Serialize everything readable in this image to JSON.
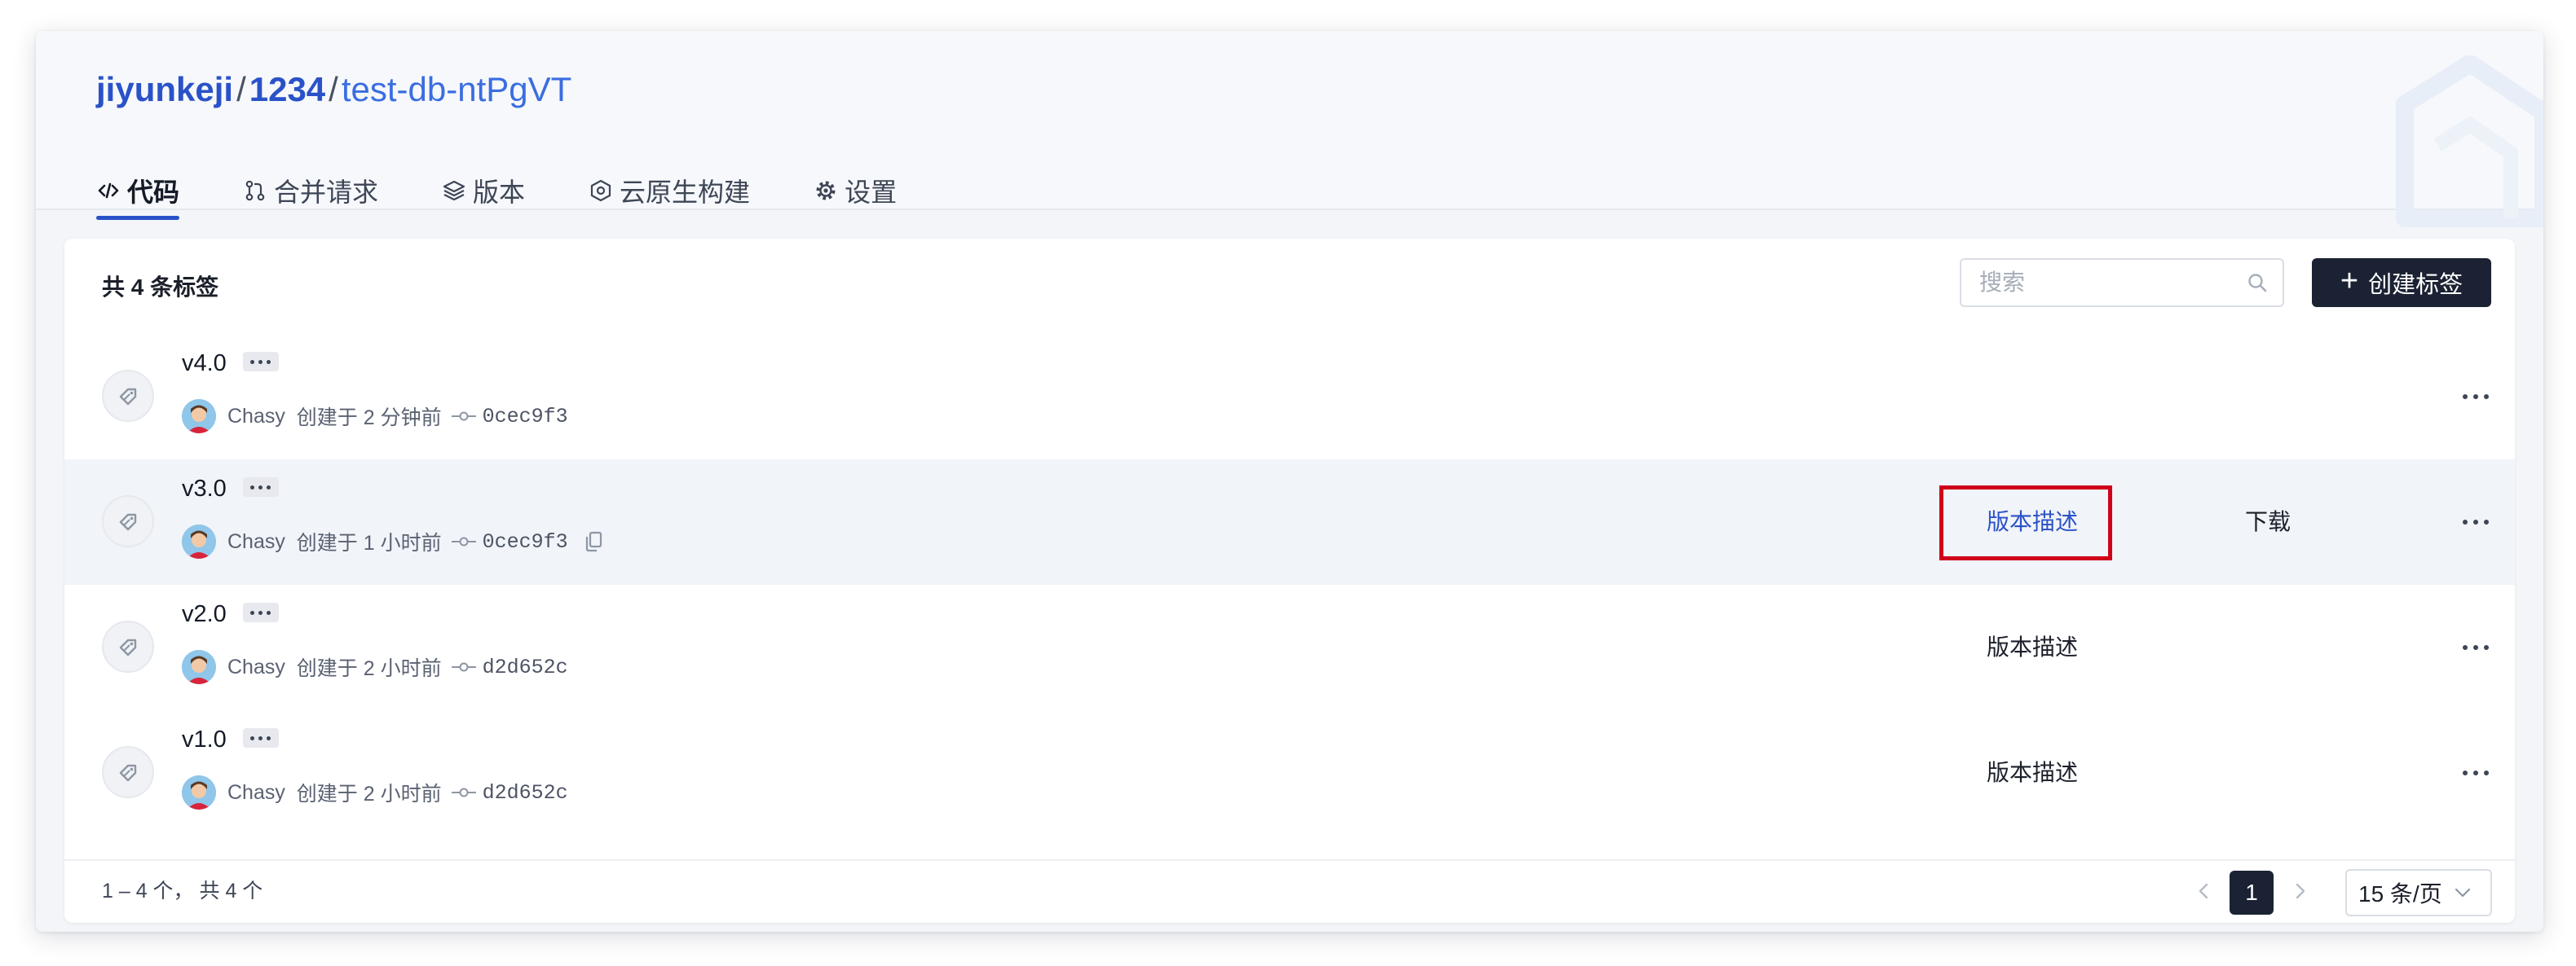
{
  "breadcrumb": {
    "owner": "jiyunkeji",
    "sep": "/",
    "group": "1234",
    "repo": "test-db-ntPgVT"
  },
  "tabs": [
    {
      "label": "代码",
      "icon": "code-icon",
      "active": true
    },
    {
      "label": "合并请求",
      "icon": "merge-request-icon",
      "active": false
    },
    {
      "label": "版本",
      "icon": "layers-icon",
      "active": false
    },
    {
      "label": "云原生构建",
      "icon": "cloud-build-icon",
      "active": false
    },
    {
      "label": "设置",
      "icon": "gear-icon",
      "active": false
    }
  ],
  "toolbar": {
    "total_text": "共 4 条标签",
    "search_placeholder": "搜索",
    "create_label": "创建标签"
  },
  "tags": [
    {
      "name": "v4.0",
      "author": "Chasy",
      "created": "创建于 2 分钟前",
      "sha": "0cec9f3",
      "description_label": "",
      "download_label": ""
    },
    {
      "name": "v3.0",
      "author": "Chasy",
      "created": "创建于 1 小时前",
      "sha": "0cec9f3",
      "description_label": "版本描述",
      "download_label": "下载"
    },
    {
      "name": "v2.0",
      "author": "Chasy",
      "created": "创建于 2 小时前",
      "sha": "d2d652c",
      "description_label": "版本描述",
      "download_label": ""
    },
    {
      "name": "v1.0",
      "author": "Chasy",
      "created": "创建于 2 小时前",
      "sha": "d2d652c",
      "description_label": "版本描述",
      "download_label": ""
    }
  ],
  "footer": {
    "range_text": "1 – 4 个， 共 4 个",
    "current_page": "1",
    "page_size": "15 条/页"
  },
  "colors": {
    "accent": "#2a52c8",
    "primary_button": "#1a2233",
    "highlight_box": "#d0021b"
  }
}
